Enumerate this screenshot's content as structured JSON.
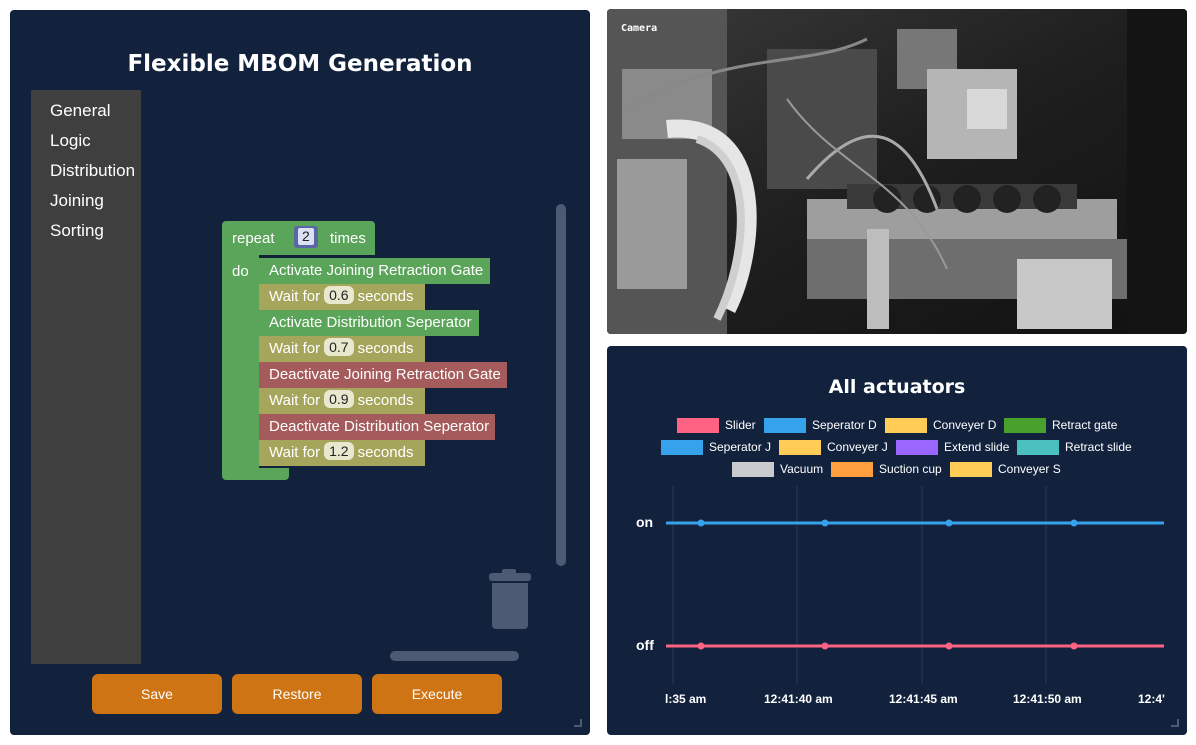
{
  "editor": {
    "title": "Flexible MBOM Generation",
    "categories": [
      "General",
      "Logic",
      "Distribution",
      "Joining",
      "Sorting"
    ],
    "repeat_label": "repeat",
    "repeat_times": "2",
    "times_label": "times",
    "do_label": "do",
    "wait_label": "Wait for",
    "seconds_label": "seconds",
    "steps": [
      {
        "type": "action",
        "text": "Activate Joining Retraction Gate"
      },
      {
        "type": "wait",
        "value": "0.6"
      },
      {
        "type": "action",
        "text": "Activate Distribution Seperator"
      },
      {
        "type": "wait",
        "value": "0.7"
      },
      {
        "type": "deactivate",
        "text": "Deactivate Joining Retraction Gate"
      },
      {
        "type": "wait",
        "value": "0.9"
      },
      {
        "type": "deactivate",
        "text": "Deactivate Distribution Seperator"
      },
      {
        "type": "wait",
        "value": "1.2"
      }
    ],
    "buttons": {
      "save": "Save",
      "restore": "Restore",
      "execute": "Execute"
    }
  },
  "camera": {
    "label": "Camera"
  },
  "chart": {
    "title": "All actuators",
    "legend": [
      {
        "name": "Slider",
        "color": "#ff6384"
      },
      {
        "name": "Seperator D",
        "color": "#36a2eb"
      },
      {
        "name": "Conveyer D",
        "color": "#ffcd56"
      },
      {
        "name": "Retract gate",
        "color": "#4aa02c"
      },
      {
        "name": "Seperator J",
        "color": "#36a2eb"
      },
      {
        "name": "Conveyer J",
        "color": "#ffcd56"
      },
      {
        "name": "Extend slide",
        "color": "#9966ff"
      },
      {
        "name": "Retract slide",
        "color": "#4bc0c0"
      },
      {
        "name": "Vacuum",
        "color": "#c9cbcf"
      },
      {
        "name": "Suction cup",
        "color": "#ff9f40"
      },
      {
        "name": "Conveyer S",
        "color": "#ffcd56"
      }
    ],
    "y_labels": [
      "on",
      "off"
    ],
    "x_labels": [
      "l:35 am",
      "12:41:40 am",
      "12:41:45 am",
      "12:41:50 am",
      "12:4'"
    ]
  },
  "chart_data": {
    "type": "line",
    "title": "All actuators",
    "y_categories": [
      "off",
      "on"
    ],
    "x": [
      "12:41:36 am",
      "12:41:41 am",
      "12:41:46 am",
      "12:41:51 am"
    ],
    "series": [
      {
        "name": "Seperator D",
        "color": "#36a2eb",
        "values": [
          "on",
          "on",
          "on",
          "on"
        ]
      },
      {
        "name": "Slider",
        "color": "#ff6384",
        "values": [
          "off",
          "off",
          "off",
          "off"
        ]
      }
    ],
    "grid": true
  }
}
